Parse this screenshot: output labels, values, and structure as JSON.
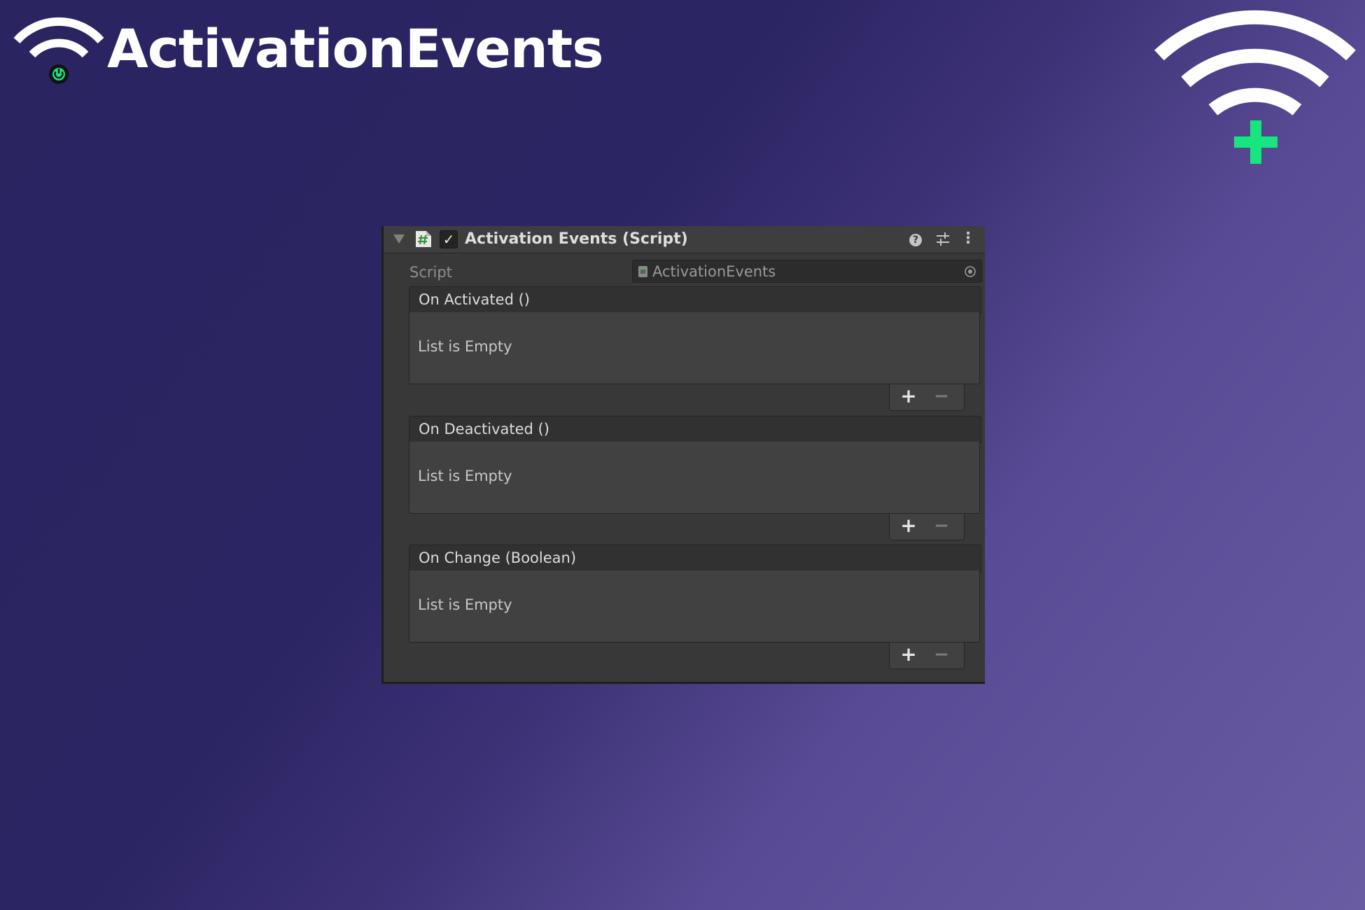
{
  "brand": {
    "title": "ActivationEvents",
    "logo_icon": "wifi-power-icon",
    "corner_icon": "wifi-plus-icon",
    "accent_color": "#17e57f"
  },
  "inspector": {
    "component_title": "Activation Events (Script)",
    "enabled": true,
    "header_icons": [
      "fold-arrow-icon",
      "csharp-script-icon",
      "checkmark-icon",
      "help-icon",
      "presets-icon",
      "kebab-menu-icon"
    ],
    "checkmark_glyph": "✓",
    "help_glyph": "?",
    "menu_glyph": "⋮",
    "script_field": {
      "label": "Script",
      "value": "ActivationEvents"
    },
    "events": [
      {
        "title": "On Activated ()",
        "empty_text": "List is Empty",
        "add_glyph": "+",
        "remove_glyph": "−"
      },
      {
        "title": "On Deactivated ()",
        "empty_text": "List is Empty",
        "add_glyph": "+",
        "remove_glyph": "−"
      },
      {
        "title": "On Change (Boolean)",
        "empty_text": "List is Empty",
        "add_glyph": "+",
        "remove_glyph": "−"
      }
    ]
  },
  "colors": {
    "panel_background": "#383838",
    "header_background": "#3e3e3e",
    "page_gradient_start": "#2a2461",
    "page_gradient_end": "#6a5ca3"
  }
}
